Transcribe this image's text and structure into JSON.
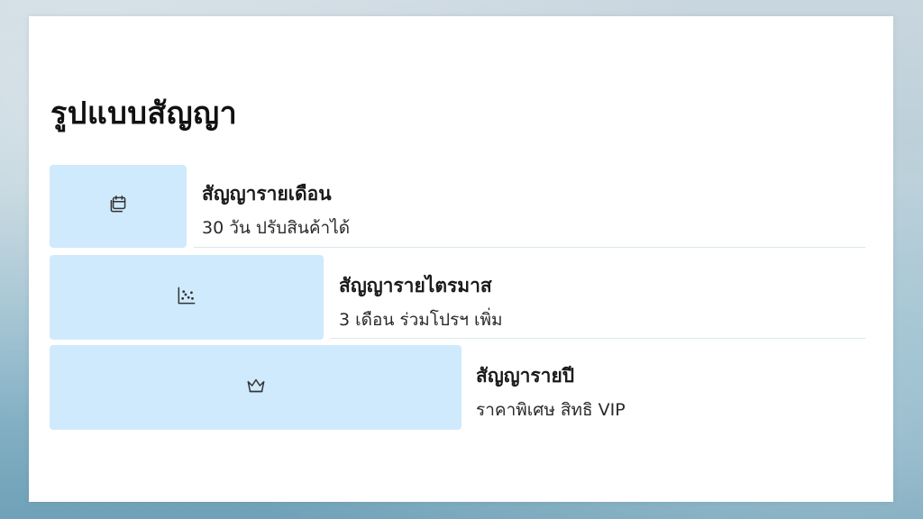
{
  "page": {
    "title": "รูปแบบสัญญา"
  },
  "contracts": [
    {
      "icon": "calendar-icon",
      "title": "สัญญารายเดือน",
      "description": "30 วัน ปรับสินค้าได้"
    },
    {
      "icon": "scatter-chart-icon",
      "title": "สัญญารายไตรมาส",
      "description": "3 เดือน ร่วมโปรฯ เพิ่ม"
    },
    {
      "icon": "crown-icon",
      "title": "สัญญารายปี",
      "description": "ราคาพิเศษ สิทธิ VIP"
    }
  ],
  "colors": {
    "tile": "#cfeafc",
    "text": "#111111",
    "divider": "#d9e6ee"
  }
}
